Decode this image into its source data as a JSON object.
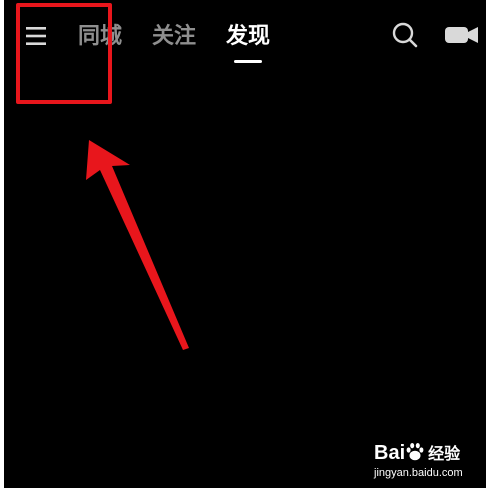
{
  "header": {
    "tabs": [
      {
        "label": "同城",
        "active": false
      },
      {
        "label": "关注",
        "active": false
      },
      {
        "label": "发现",
        "active": true
      }
    ],
    "icons": {
      "menu": "hamburger-menu-icon",
      "search": "search-icon",
      "camera": "video-camera-icon"
    }
  },
  "annotation": {
    "highlight_color": "#e8161c",
    "target": "hamburger-menu-icon"
  },
  "watermark": {
    "brand_prefix": "Bai",
    "brand_suffix": "经验",
    "url": "jingyan.baidu.com"
  },
  "colors": {
    "background": "#000000",
    "tab_inactive": "#8f8f8f",
    "tab_active": "#ffffff",
    "icon": "#d9d9d9"
  }
}
